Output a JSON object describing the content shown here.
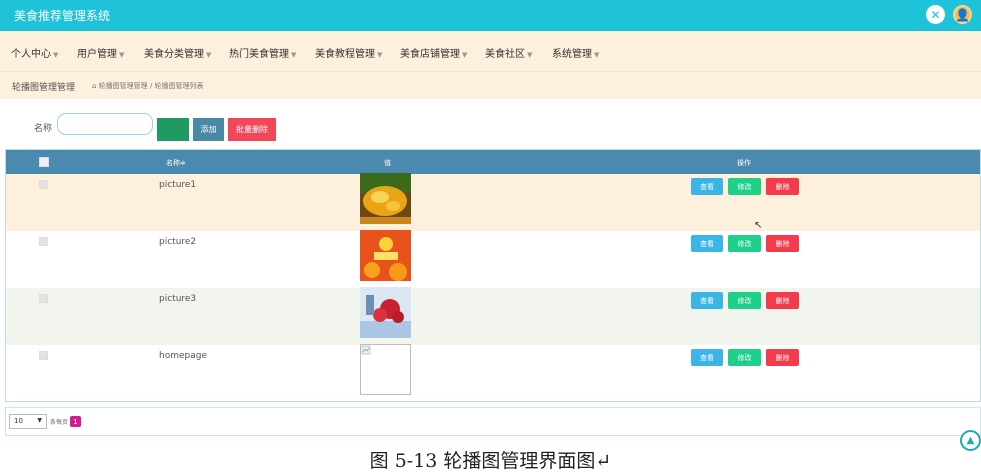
{
  "app": {
    "title": "美食推荐管理系统"
  },
  "topbar": {
    "icons": [
      "close-circle-icon",
      "user-avatar-icon"
    ]
  },
  "nav": {
    "items": [
      {
        "label": "个人中心"
      },
      {
        "label": "用户管理"
      },
      {
        "label": "美食分类管理"
      },
      {
        "label": "热门美食管理"
      },
      {
        "label": "美食教程管理"
      },
      {
        "label": "美食店铺管理"
      },
      {
        "label": "美食社区"
      },
      {
        "label": "系统管理"
      }
    ]
  },
  "breadcrumb": {
    "title": "轮播图管理管理",
    "path": "轮播图管理管理 / 轮播图管理列表"
  },
  "search": {
    "name_label": "名称",
    "name_value": "",
    "search_label": "",
    "add_label": "添加",
    "batch_delete_label": "批量删除"
  },
  "table": {
    "headers": {
      "name": "名称≑",
      "value": "值",
      "actions": "操作"
    },
    "rows": [
      {
        "name": "picture1",
        "image": "dessert-photo",
        "view": "查看",
        "edit": "修改",
        "delete": "删除"
      },
      {
        "name": "picture2",
        "image": "orange-promo-poster",
        "view": "查看",
        "edit": "修改",
        "delete": "删除"
      },
      {
        "name": "picture3",
        "image": "red-berries-photo",
        "view": "查看",
        "edit": "修改",
        "delete": "删除"
      },
      {
        "name": "homepage",
        "image": "broken-image",
        "view": "查看",
        "edit": "修改",
        "delete": "删除"
      }
    ]
  },
  "pagination": {
    "page_size": "10",
    "per_page_label": "条每页",
    "current_page": "1"
  },
  "colors": {
    "topbar": "#1fc3d9",
    "nav": "#fdf0dd",
    "table_header": "#4a8aae",
    "view": "#3bb5e6",
    "edit": "#1ed08a",
    "delete": "#f23c4c",
    "page_active": "#d31b8b"
  },
  "caption": "图 5-13 轮播图管理界面图↵"
}
